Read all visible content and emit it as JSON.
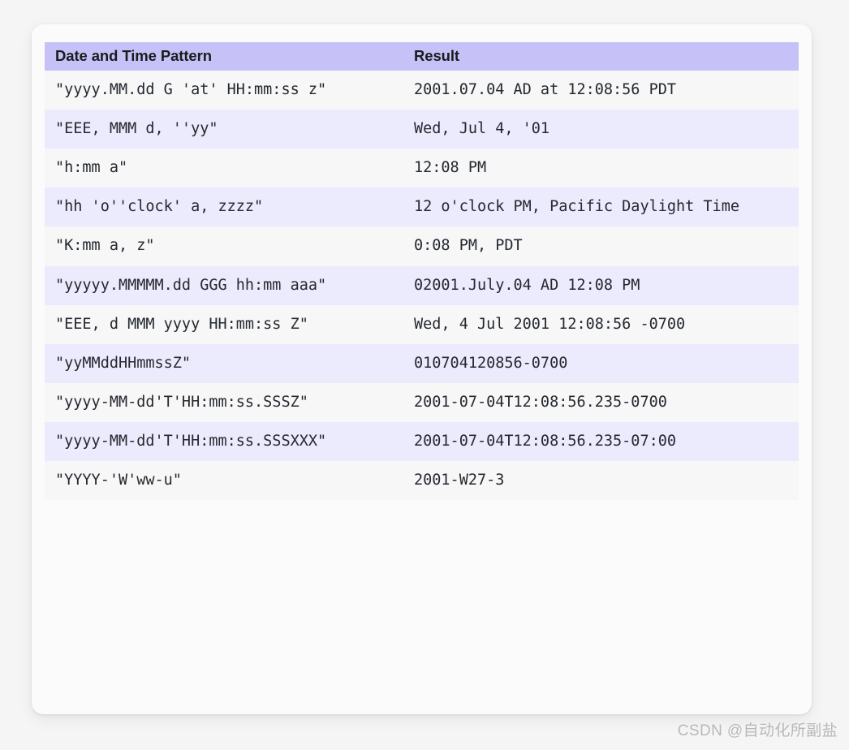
{
  "table": {
    "columns": [
      {
        "key": "pattern",
        "label": "Date and Time Pattern"
      },
      {
        "key": "result",
        "label": "Result"
      }
    ],
    "header_background": "#c6c2f7",
    "row_background_even": "#f7f7f8",
    "row_background_odd": "#eceafd",
    "rows": [
      {
        "pattern": "\"yyyy.MM.dd G 'at' HH:mm:ss z\"",
        "result": "2001.07.04 AD at 12:08:56 PDT"
      },
      {
        "pattern": "\"EEE, MMM d, ''yy\"",
        "result": "Wed, Jul 4, '01"
      },
      {
        "pattern": "\"h:mm a\"",
        "result": "12:08 PM"
      },
      {
        "pattern": "\"hh 'o''clock' a, zzzz\"",
        "result": "12 o'clock PM, Pacific Daylight Time"
      },
      {
        "pattern": "\"K:mm a, z\"",
        "result": "0:08 PM, PDT"
      },
      {
        "pattern": "\"yyyyy.MMMMM.dd GGG hh:mm aaa\"",
        "result": "02001.July.04 AD 12:08 PM"
      },
      {
        "pattern": "\"EEE, d MMM yyyy HH:mm:ss Z\"",
        "result": "Wed, 4 Jul 2001 12:08:56 -0700"
      },
      {
        "pattern": "\"yyMMddHHmmssZ\"",
        "result": "010704120856-0700"
      },
      {
        "pattern": "\"yyyy-MM-dd'T'HH:mm:ss.SSSZ\"",
        "result": "2001-07-04T12:08:56.235-0700"
      },
      {
        "pattern": "\"yyyy-MM-dd'T'HH:mm:ss.SSSXXX\"",
        "result": "2001-07-04T12:08:56.235-07:00"
      },
      {
        "pattern": "\"YYYY-'W'ww-u\"",
        "result": "2001-W27-3"
      }
    ]
  },
  "watermark": {
    "text": "CSDN @自动化所副盐"
  }
}
